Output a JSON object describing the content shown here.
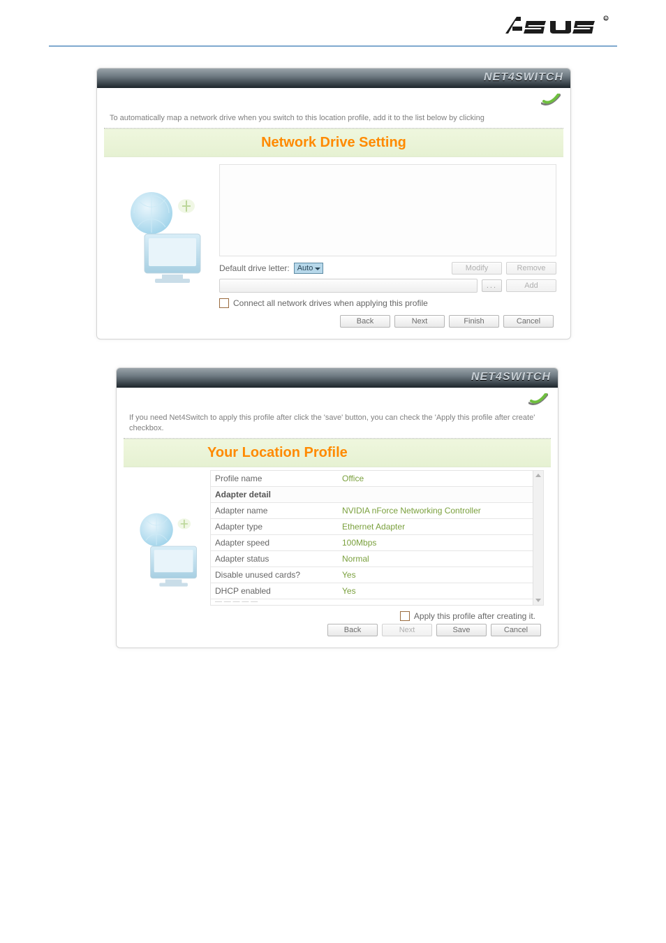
{
  "brand": {
    "app_name": "NET4SWITCH"
  },
  "panel1": {
    "hint": "To automatically map a network drive when you switch to this location profile, add it to the list below by clicking",
    "section_title": "Network Drive Setting",
    "drive_letter_label": "Default drive letter:",
    "drive_letter_value": "Auto",
    "modify_label": "Modify",
    "remove_label": "Remove",
    "browse_label": "...",
    "add_label": "Add",
    "connect_all_label": "Connect all network drives when applying this profile",
    "buttons": {
      "back": "Back",
      "next": "Next",
      "finish": "Finish",
      "cancel": "Cancel"
    }
  },
  "panel2": {
    "hint": "If you need Net4Switch to apply this profile after click the 'save' button, you can check the 'Apply this profile after create' checkbox.",
    "section_title": "Your Location Profile",
    "rows": {
      "profile_name_k": "Profile name",
      "profile_name_v": "Office",
      "adapter_detail": "Adapter detail",
      "adapter_name_k": "Adapter name",
      "adapter_name_v": "NVIDIA nForce Networking Controller",
      "adapter_type_k": "Adapter type",
      "adapter_type_v": "Ethernet Adapter",
      "adapter_speed_k": "Adapter speed",
      "adapter_speed_v": "100Mbps",
      "adapter_status_k": "Adapter status",
      "adapter_status_v": "Normal",
      "disable_unused_k": "Disable unused cards?",
      "disable_unused_v": "Yes",
      "dhcp_enabled_k": "DHCP enabled",
      "dhcp_enabled_v": "Yes"
    },
    "apply_label": "Apply this profile after creating it.",
    "buttons": {
      "back": "Back",
      "next": "Next",
      "save": "Save",
      "cancel": "Cancel"
    }
  }
}
